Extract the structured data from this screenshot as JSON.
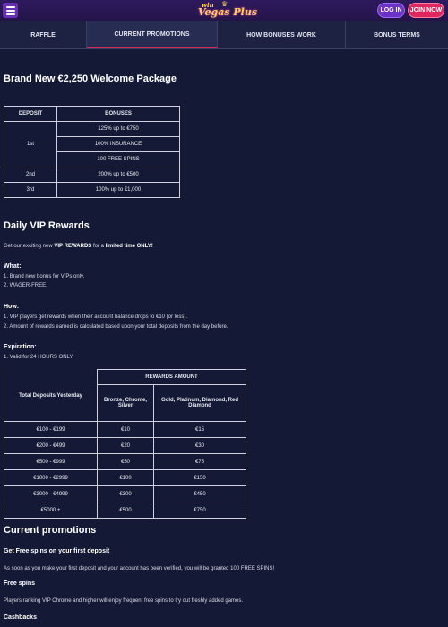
{
  "header": {
    "logo_small": "win",
    "logo_main": "Vegas Plus",
    "login_label": "LOG IN",
    "join_label": "JOIN NOW"
  },
  "tabs": [
    {
      "label": "RAFFLE"
    },
    {
      "label": "CURRENT PROMOTIONS"
    },
    {
      "label": "HOW BONUSES WORK"
    },
    {
      "label": "BONUS TERMS"
    }
  ],
  "welcome": {
    "title": "Brand New €2,250 Welcome Package",
    "headers": [
      "DEPOSIT",
      "BONUSES"
    ],
    "first_deposit": "1st",
    "first_bonuses": [
      "125% up to €750",
      "100% INSURANCE",
      "100 FREE SPINS"
    ],
    "rows": [
      {
        "deposit": "2nd",
        "bonus": "200% up to €500"
      },
      {
        "deposit": "3rd",
        "bonus": "100% up to €1,000"
      }
    ]
  },
  "vip": {
    "title": "Daily VIP Rewards",
    "intro_pre": "Get our exciting new ",
    "intro_bold1": "VIP REWARDS",
    "intro_mid": " for a ",
    "intro_bold2": "limited time ONLY!",
    "what_label": "What:",
    "what_items": [
      "1. Brand new bonus for VIPs only.",
      "2. WAGER-FREE."
    ],
    "how_label": "How:",
    "how_items": [
      "1. VIP players get rewards when their account balance drops to €10 (or less).",
      "2. Amount of rewards earned is calculated based upon your total deposits from the day before."
    ],
    "exp_label": "Expiration:",
    "exp_items": [
      "1. Valid for 24 HOURS ONLY."
    ],
    "table": {
      "rewards_header": "REWARDS AMOUNT",
      "col1": "Total Deposits Yesterday",
      "col2": "Bronze, Chrome, Silver",
      "col3": "Gold, Platinum, Diamond, Red Diamond",
      "rows": [
        [
          "€100 - €199",
          "€10",
          "€15"
        ],
        [
          "€200 - €499",
          "€20",
          "€30"
        ],
        [
          "€500 - €999",
          "€50",
          "€75"
        ],
        [
          "€1000 - €2999",
          "€100",
          "€150"
        ],
        [
          "€3000 - €4999",
          "€300",
          "€450"
        ],
        [
          "€5000 +",
          "€500",
          "€750"
        ]
      ]
    }
  },
  "current": {
    "title": "Current promotions",
    "sub1": "Get Free spins on your first deposit",
    "text1": "As soon as you make your first deposit and your account has been verified, you will be granted 100 FREE SPINS!",
    "sub2": "Free spins",
    "text2": "Players ranking VIP Chrome and higher will enjoy frequent free spins to try out freshly added games.",
    "sub3": "Cashbacks"
  }
}
